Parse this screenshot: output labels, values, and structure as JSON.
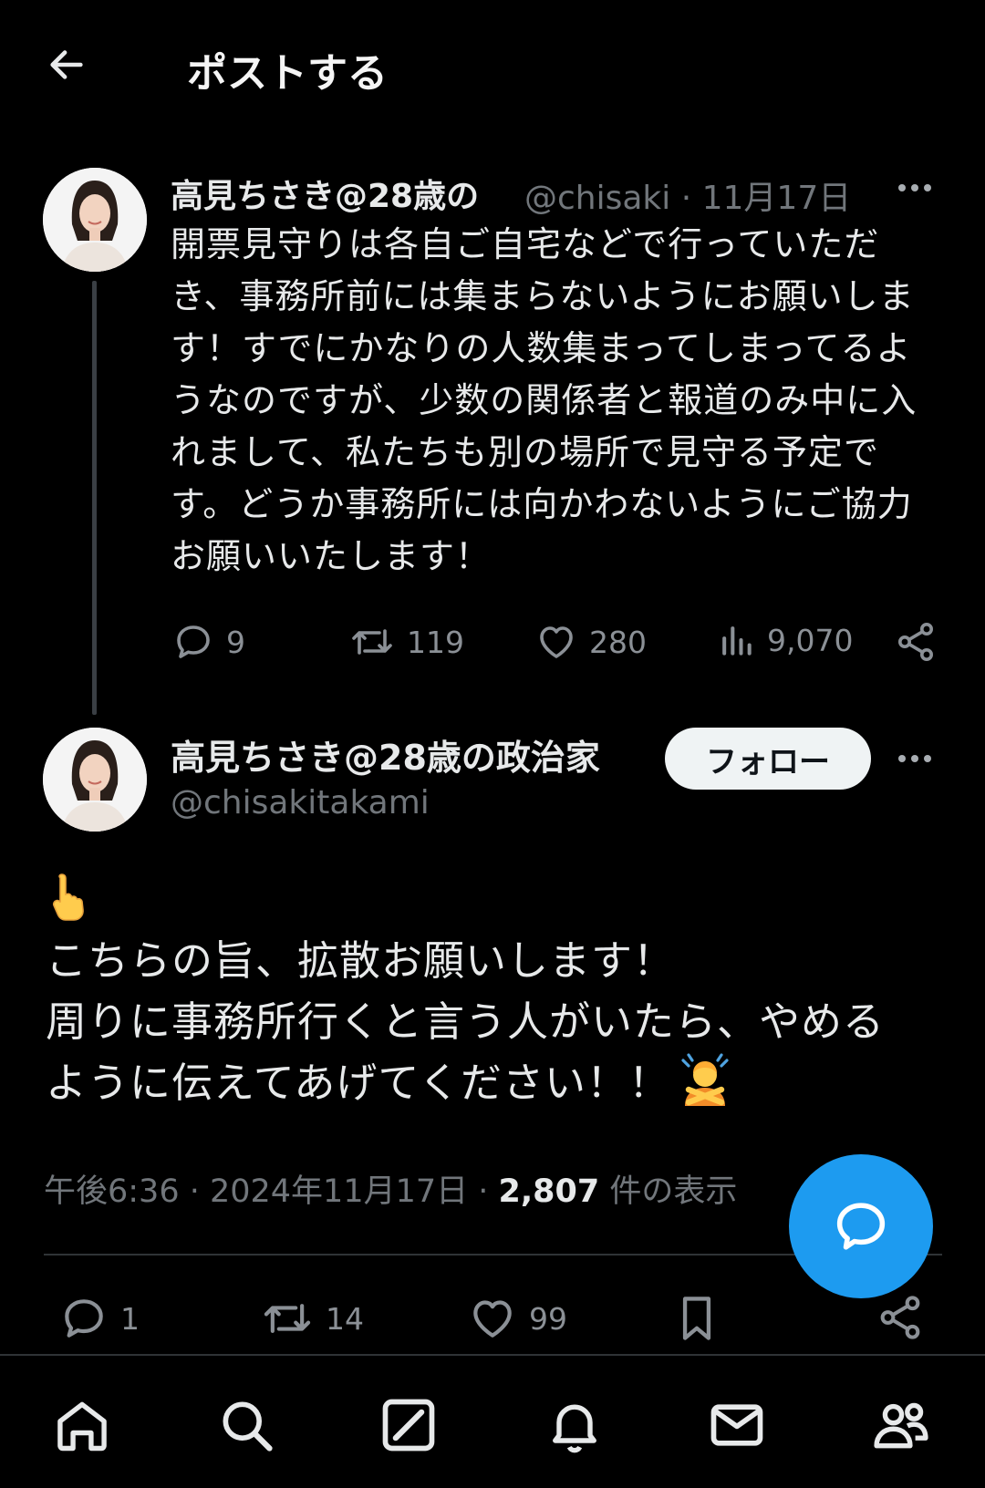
{
  "header": {
    "title": "ポストする",
    "back_icon": "arrow-left-icon"
  },
  "tweet1": {
    "name": "高見ちさき@28歳の",
    "handle_time": "@chisaki · 11月17日",
    "text": "開票見守りは各自ご自宅などで行っていただき、事務所前には集まらないようにお願いします！すでにかなりの人数集まってしまってるようなのですが、少数の関係者と報道のみ中に入れまして、私たちも別の場所で見守る予定です。どうか事務所には向かわないようにご協力お願いいたします！",
    "replies": "9",
    "reposts": "119",
    "likes": "280",
    "views": "9,070"
  },
  "tweet2": {
    "name": "高見ちさき@28歳の政治家",
    "handle": "@chisakitakami",
    "follow_label": "フォロー",
    "emoji_hand": "👆",
    "lines": [
      "こちらの旨、拡散お願いします！",
      "周りに事務所行くと言う人がいたら、やめる",
      "ように伝えてあげてください！！"
    ],
    "emoji_person": "🙅",
    "time": "午後6:36 · 2024年11月17日 · ",
    "views_count": "2,807",
    "views_label": " 件の表示",
    "replies": "1",
    "reposts": "14",
    "likes": "99"
  },
  "colors": {
    "accent": "#1d9bf0",
    "background": "#000000",
    "muted": "#71767b"
  },
  "nav_icons": [
    "home-icon",
    "search-icon",
    "grok-icon",
    "notifications-icon",
    "messages-icon",
    "communities-icon"
  ]
}
